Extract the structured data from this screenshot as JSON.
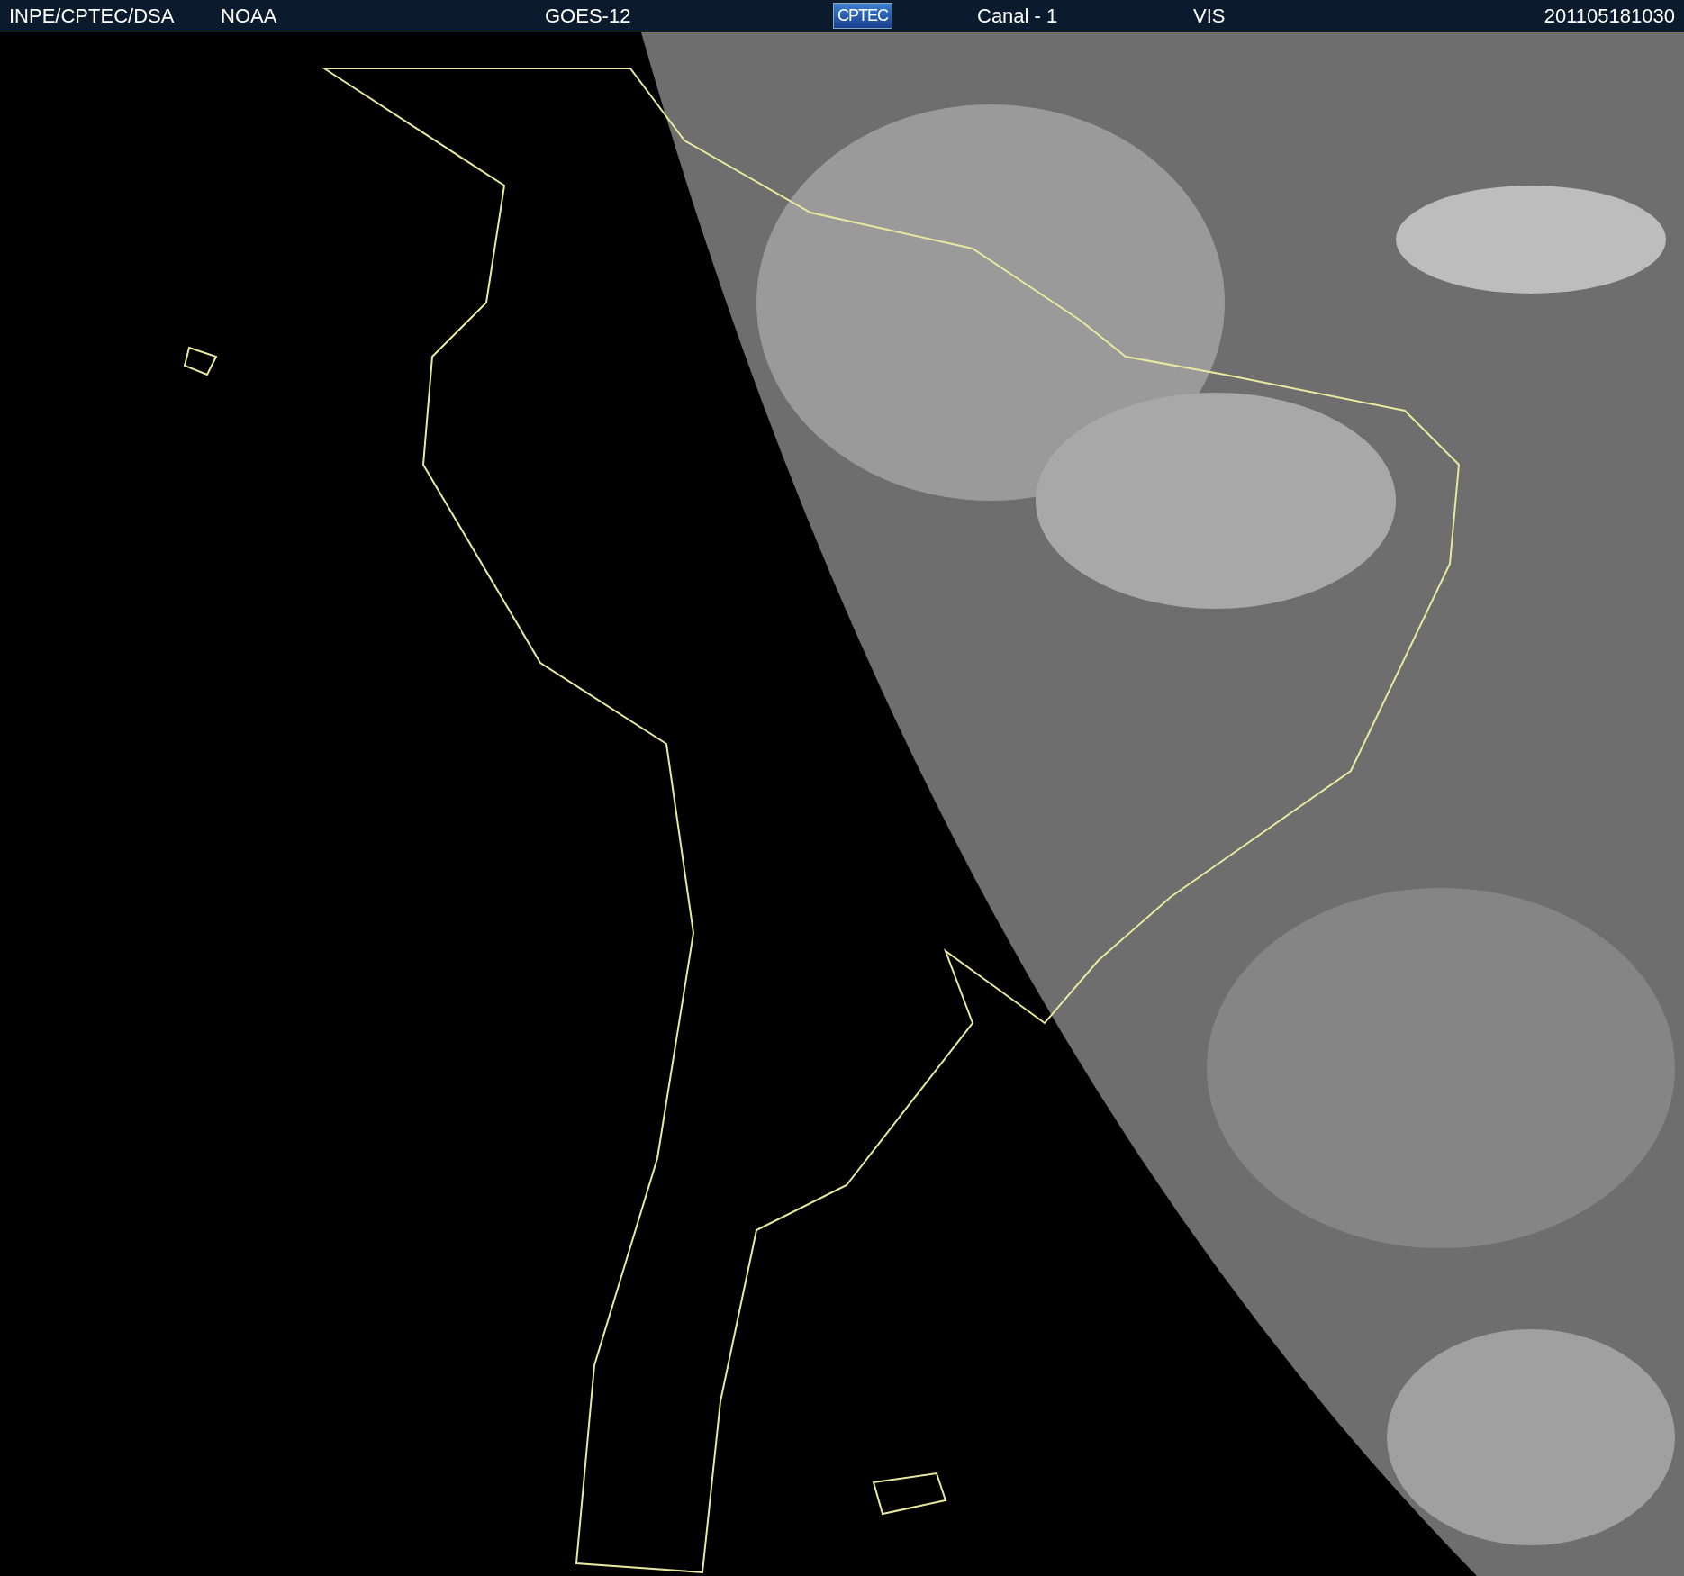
{
  "header": {
    "items": [
      {
        "kind": "text",
        "text": "INPE/CPTEC/DSA"
      },
      {
        "kind": "text",
        "text": "NOAA"
      },
      {
        "kind": "text",
        "text": "GOES-12"
      },
      {
        "kind": "logo",
        "text": "CPTEC"
      },
      {
        "kind": "text",
        "text": "Canal - 1"
      },
      {
        "kind": "text",
        "text": "VIS"
      },
      {
        "kind": "text",
        "text": "201105181030"
      }
    ]
  }
}
